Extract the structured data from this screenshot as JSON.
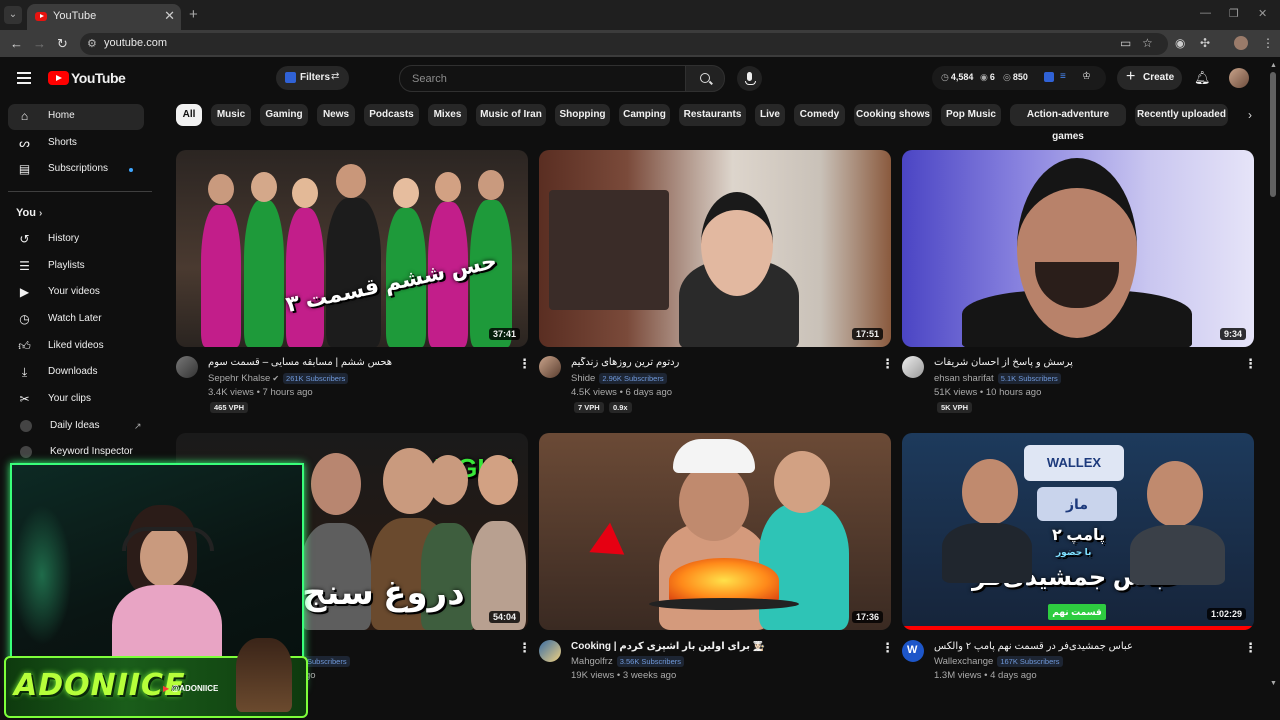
{
  "browser": {
    "tab_title": "YouTube",
    "url": "youtube.com"
  },
  "header": {
    "logo_text": "YouTube",
    "filters_label": "Filters",
    "search_placeholder": "Search",
    "stats": {
      "views": "4,584",
      "eye": "6",
      "watch": "850"
    },
    "create_label": "Create"
  },
  "sidebar": {
    "items": [
      {
        "label": "Home",
        "icon": "home-icon"
      },
      {
        "label": "Shorts",
        "icon": "shorts-icon"
      },
      {
        "label": "Subscriptions",
        "icon": "subscriptions-icon"
      }
    ],
    "you_heading": "You",
    "you_items": [
      {
        "label": "History"
      },
      {
        "label": "Playlists"
      },
      {
        "label": "Your videos"
      },
      {
        "label": "Watch Later"
      },
      {
        "label": "Liked videos"
      },
      {
        "label": "Downloads"
      },
      {
        "label": "Your clips"
      },
      {
        "label": "Daily Ideas"
      },
      {
        "label": "Keyword Inspector"
      }
    ]
  },
  "chips": [
    "All",
    "Music",
    "Gaming",
    "News",
    "Podcasts",
    "Mixes",
    "Music of Iran",
    "Shopping",
    "Camping",
    "Restaurants",
    "Live",
    "Comedy",
    "Cooking shows",
    "Pop Music",
    "Action-adventure games",
    "Recently uploaded"
  ],
  "videos": [
    {
      "title": "هحس ششم | مسابقه مسایی – قسمت سوم",
      "channel": "Sepehr Khalse",
      "subs": "261K Subscribers",
      "meta": "3.4K views • 7 hours ago",
      "vph": "465 VPH",
      "duration": "37:41",
      "thumb_text": "حس ششم قسمت ۳"
    },
    {
      "title": "ردتوم ترین روزهای زندگیم",
      "channel": "Shide",
      "subs": "2.96K Subscribers",
      "meta": "4.5K views • 6 days ago",
      "vph": "7 VPH",
      "vph2": "0.9x",
      "duration": "17:51"
    },
    {
      "title": "پرسش و پاسخ از احسان شریفات",
      "channel": "ehsan sharifat",
      "subs": "5.1K Subscribers",
      "meta": "51K views • 10 hours ago",
      "vph": "5K VPH",
      "duration": "9:34"
    },
    {
      "title": "",
      "channel": "",
      "subs": "Subscribers",
      "meta": "go",
      "duration": "54:04",
      "thumb_text": "دروغ سنج",
      "thumb_text2": "FIGHT"
    },
    {
      "title": "Cooking | برای اولین بار آشپزی کردم 👩🏻‍🍳",
      "channel": "Mahgolfrz",
      "subs": "3.56K Subscribers",
      "meta": "19K views • 3 weeks ago",
      "duration": "17:36"
    },
    {
      "title": "عباس جمشیدی‌فر در قسمت نهم پامپ ۲ والکس",
      "channel": "Wallexchange",
      "subs": "167K Subscribers",
      "meta": "1.3M views • 4 days ago",
      "duration": "1:02:29",
      "thumb_brand": "WALLEX",
      "thumb_badge": "ماز",
      "thumb_title": "پامپ ۲",
      "thumb_sub": "با حضور",
      "thumb_name": "عباس جمشیدی‌فر",
      "thumb_episode": "قسمت نهم"
    }
  ],
  "overlay": {
    "streamer_name": "ADONIICE",
    "handle": "@ADONIICE"
  },
  "colors": {
    "accent": "#ff0000",
    "neon": "#39ff7a",
    "link": "#3ea6ff"
  }
}
